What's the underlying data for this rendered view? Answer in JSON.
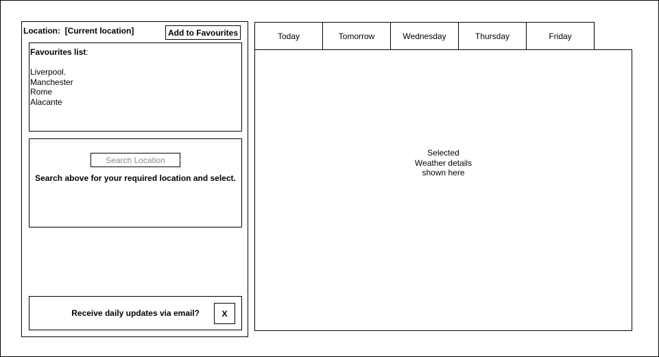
{
  "location": {
    "label": "Location:  [Current location]",
    "add_favourite_button": "Add to Favourites"
  },
  "favourites": {
    "title": "Favourites list",
    "title_suffix": ":",
    "items": [
      "Liverpool.",
      "Manchester",
      "Rome",
      "Alacante"
    ]
  },
  "search": {
    "placeholder": "Search Location",
    "hint": "Search above for your required location and select."
  },
  "email": {
    "prompt": "Receive daily updates via email?",
    "toggle_label": "X"
  },
  "tabs": [
    "Today",
    "Tomorrow",
    "Wednesday",
    "Thursday",
    "Friday"
  ],
  "details": {
    "lines": [
      "Selected",
      "Weather details",
      "shown here"
    ]
  }
}
